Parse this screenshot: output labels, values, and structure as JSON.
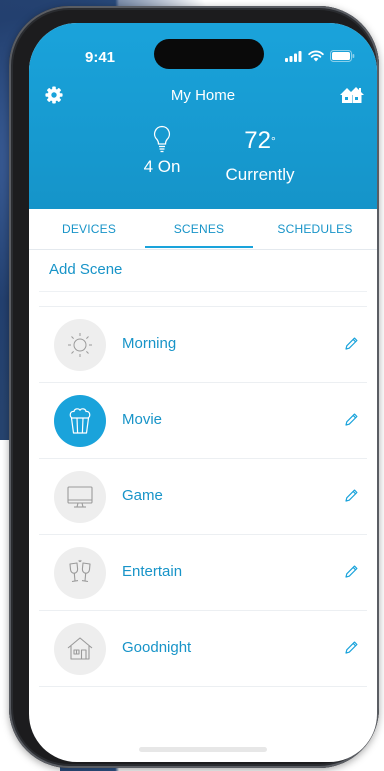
{
  "status_bar": {
    "time": "9:41"
  },
  "header": {
    "title": "My Home",
    "lights_on": "4 On",
    "temperature": "72",
    "temperature_unit": "°",
    "temperature_label": "Currently"
  },
  "tabs": [
    {
      "label": "DEVICES",
      "active": false
    },
    {
      "label": "SCENES",
      "active": true
    },
    {
      "label": "SCHEDULES",
      "active": false
    }
  ],
  "add_scene_label": "Add Scene",
  "scenes": [
    {
      "label": "Morning",
      "icon": "sun-icon",
      "active": false
    },
    {
      "label": "Movie",
      "icon": "popcorn-icon",
      "active": true
    },
    {
      "label": "Game",
      "icon": "monitor-icon",
      "active": false
    },
    {
      "label": "Entertain",
      "icon": "glasses-toast-icon",
      "active": false
    },
    {
      "label": "Goodnight",
      "icon": "house-icon",
      "active": false
    }
  ],
  "colors": {
    "accent": "#1aa3db",
    "text_accent": "#1894c8",
    "icon_bg": "#eeeeee"
  }
}
